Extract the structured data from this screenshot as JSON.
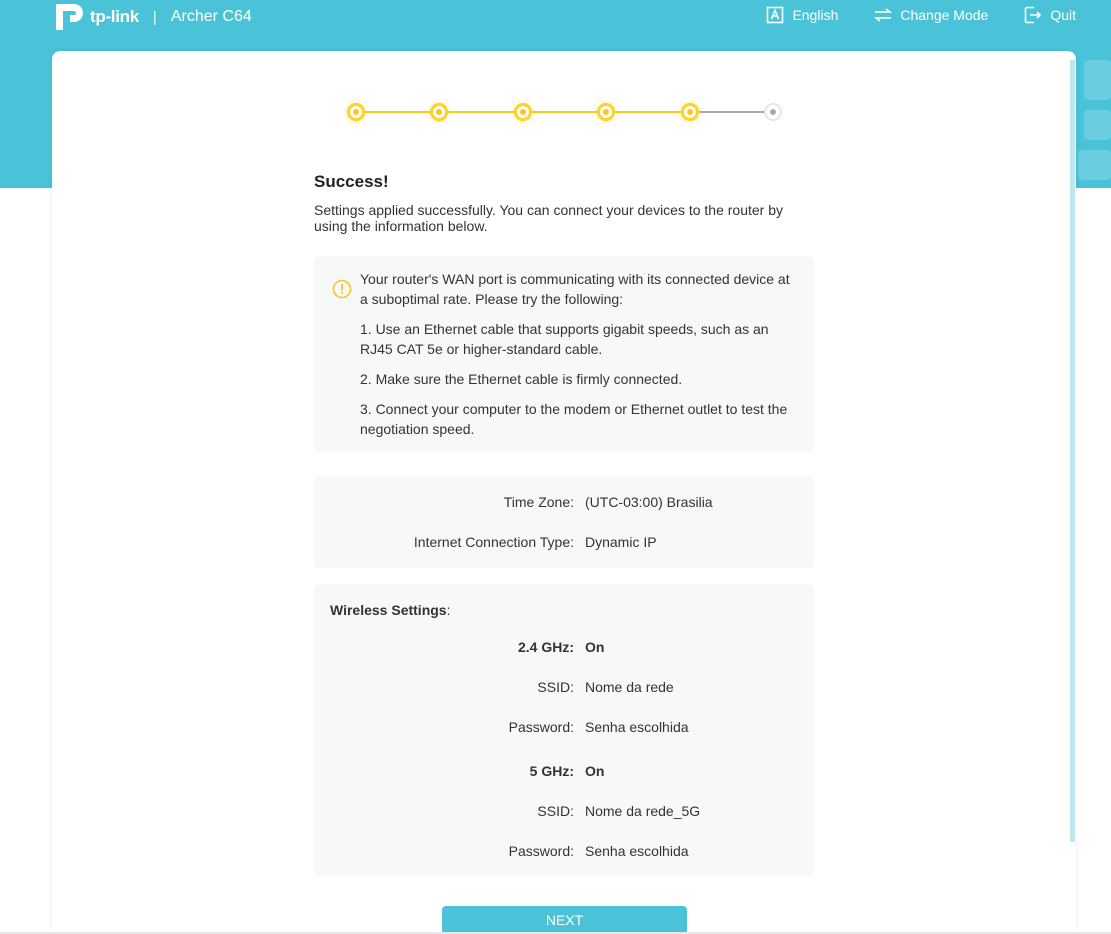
{
  "colors": {
    "brand": "#4ac3d9",
    "step_active": "#fcc521",
    "step_inactive": "#aaaaaa",
    "panel": "#f7f8f8",
    "warning": "#fcc521"
  },
  "header": {
    "logo_text": "tp-link",
    "separator": "|",
    "model": "Archer C64",
    "language_label": "English",
    "change_mode_label": "Change Mode",
    "quit_label": "Quit"
  },
  "stepper": {
    "total_steps": 6,
    "completed_steps": 5
  },
  "main": {
    "title": "Success!",
    "subtitle": "Settings applied successfully. You can connect your devices to the router by using the information below."
  },
  "warning": {
    "icon": "warning-circle-icon",
    "intro": "Your router's WAN port is communicating with its connected device at a suboptimal rate. Please try the following:",
    "items": [
      "1. Use an Ethernet cable that supports gigabit speeds, such as an RJ45 CAT 5e or higher-standard cable.",
      "2. Make sure the Ethernet cable is firmly connected.",
      "3. Connect your computer to the modem or Ethernet outlet to test the negotiation speed."
    ]
  },
  "info": {
    "time_zone_label": "Time Zone:",
    "time_zone_value": "(UTC-03:00) Brasilia",
    "connection_label": "Internet Connection Type:",
    "connection_value": "Dynamic IP"
  },
  "wireless": {
    "title": "Wireless Settings",
    "title_suffix": ":",
    "band24": {
      "label": "2.4 GHz:",
      "status": "On",
      "ssid_label": "SSID:",
      "ssid": "Nome da rede",
      "password_label": "Password:",
      "password": "Senha escolhida"
    },
    "band5": {
      "label": "5 GHz:",
      "status": "On",
      "ssid_label": "SSID:",
      "ssid": "Nome da rede_5G",
      "password_label": "Password:",
      "password": "Senha escolhida"
    }
  },
  "footer": {
    "next_label": "NEXT"
  }
}
